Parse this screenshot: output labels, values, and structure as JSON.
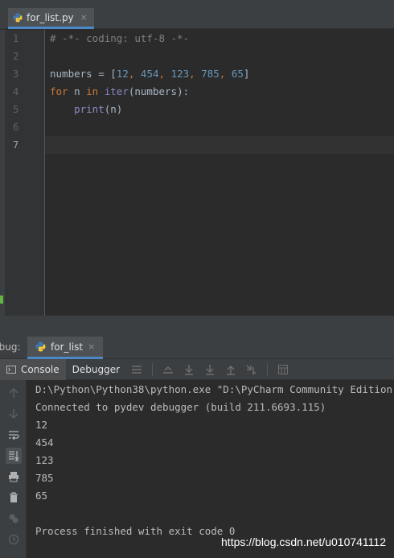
{
  "editor_tab": {
    "filename": "for_list.py",
    "close": "×"
  },
  "editor": {
    "line_numbers": [
      "1",
      "2",
      "3",
      "4",
      "5",
      "6",
      "7"
    ],
    "lines": {
      "l1": {
        "comment": "# -*- coding: utf-8 -*-"
      },
      "l3": {
        "var": "numbers = [",
        "n1": "12",
        "c1": ", ",
        "n2": "454",
        "c2": ", ",
        "n3": "123",
        "c3": ", ",
        "n4": "785",
        "c4": ", ",
        "n5": "65",
        "end": "]"
      },
      "l4": {
        "kw1": "for",
        "mid1": " n ",
        "kw2": "in",
        "sp": " ",
        "fn": "iter",
        "rest": "(numbers):"
      },
      "l5": {
        "indent": "    ",
        "fn": "print",
        "rest": "(n)"
      }
    }
  },
  "debug": {
    "label": "Debug:",
    "tab": "for_list",
    "close": "×",
    "toolbar": {
      "console": "Console",
      "debugger": "Debugger"
    }
  },
  "console": {
    "lines": [
      "D:\\Python\\Python38\\python.exe \"D:\\PyCharm Community Edition",
      "Connected to pydev debugger (build 211.6693.115)",
      "12",
      "454",
      "123",
      "785",
      "65",
      "",
      "Process finished with exit code 0"
    ]
  },
  "watermark": "https://blog.csdn.net/u010741112",
  "colors": {
    "keyword": "#cc7832",
    "number": "#6897bb",
    "comment": "#808080",
    "builtin": "#8888c6",
    "accent": "#4a88c7"
  }
}
